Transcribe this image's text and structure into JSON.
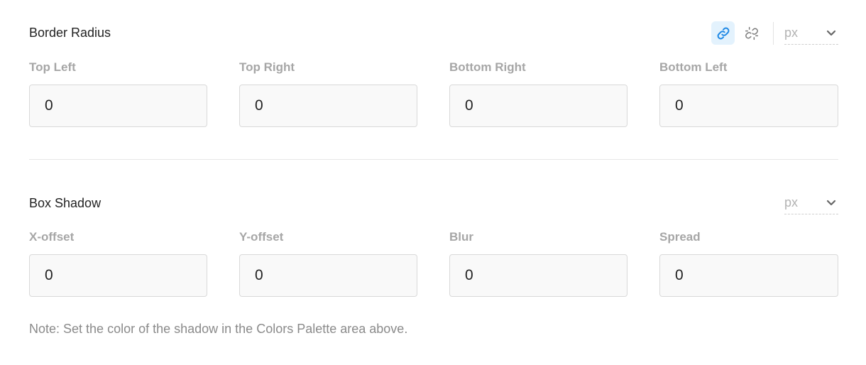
{
  "border_radius": {
    "title": "Border Radius",
    "unit": "px",
    "link_icon": "link-icon",
    "unlink_icon": "unlink-icon",
    "linked": true,
    "fields": [
      {
        "label": "Top Left",
        "value": "0"
      },
      {
        "label": "Top Right",
        "value": "0"
      },
      {
        "label": "Bottom Right",
        "value": "0"
      },
      {
        "label": "Bottom Left",
        "value": "0"
      }
    ]
  },
  "box_shadow": {
    "title": "Box Shadow",
    "unit": "px",
    "fields": [
      {
        "label": "X-offset",
        "value": "0"
      },
      {
        "label": "Y-offset",
        "value": "0"
      },
      {
        "label": "Blur",
        "value": "0"
      },
      {
        "label": "Spread",
        "value": "0"
      }
    ],
    "note": "Note: Set the color of the shadow in the Colors Palette area above."
  },
  "colors": {
    "accent": "#1e88e5",
    "active_bg": "#e3f2fd"
  }
}
